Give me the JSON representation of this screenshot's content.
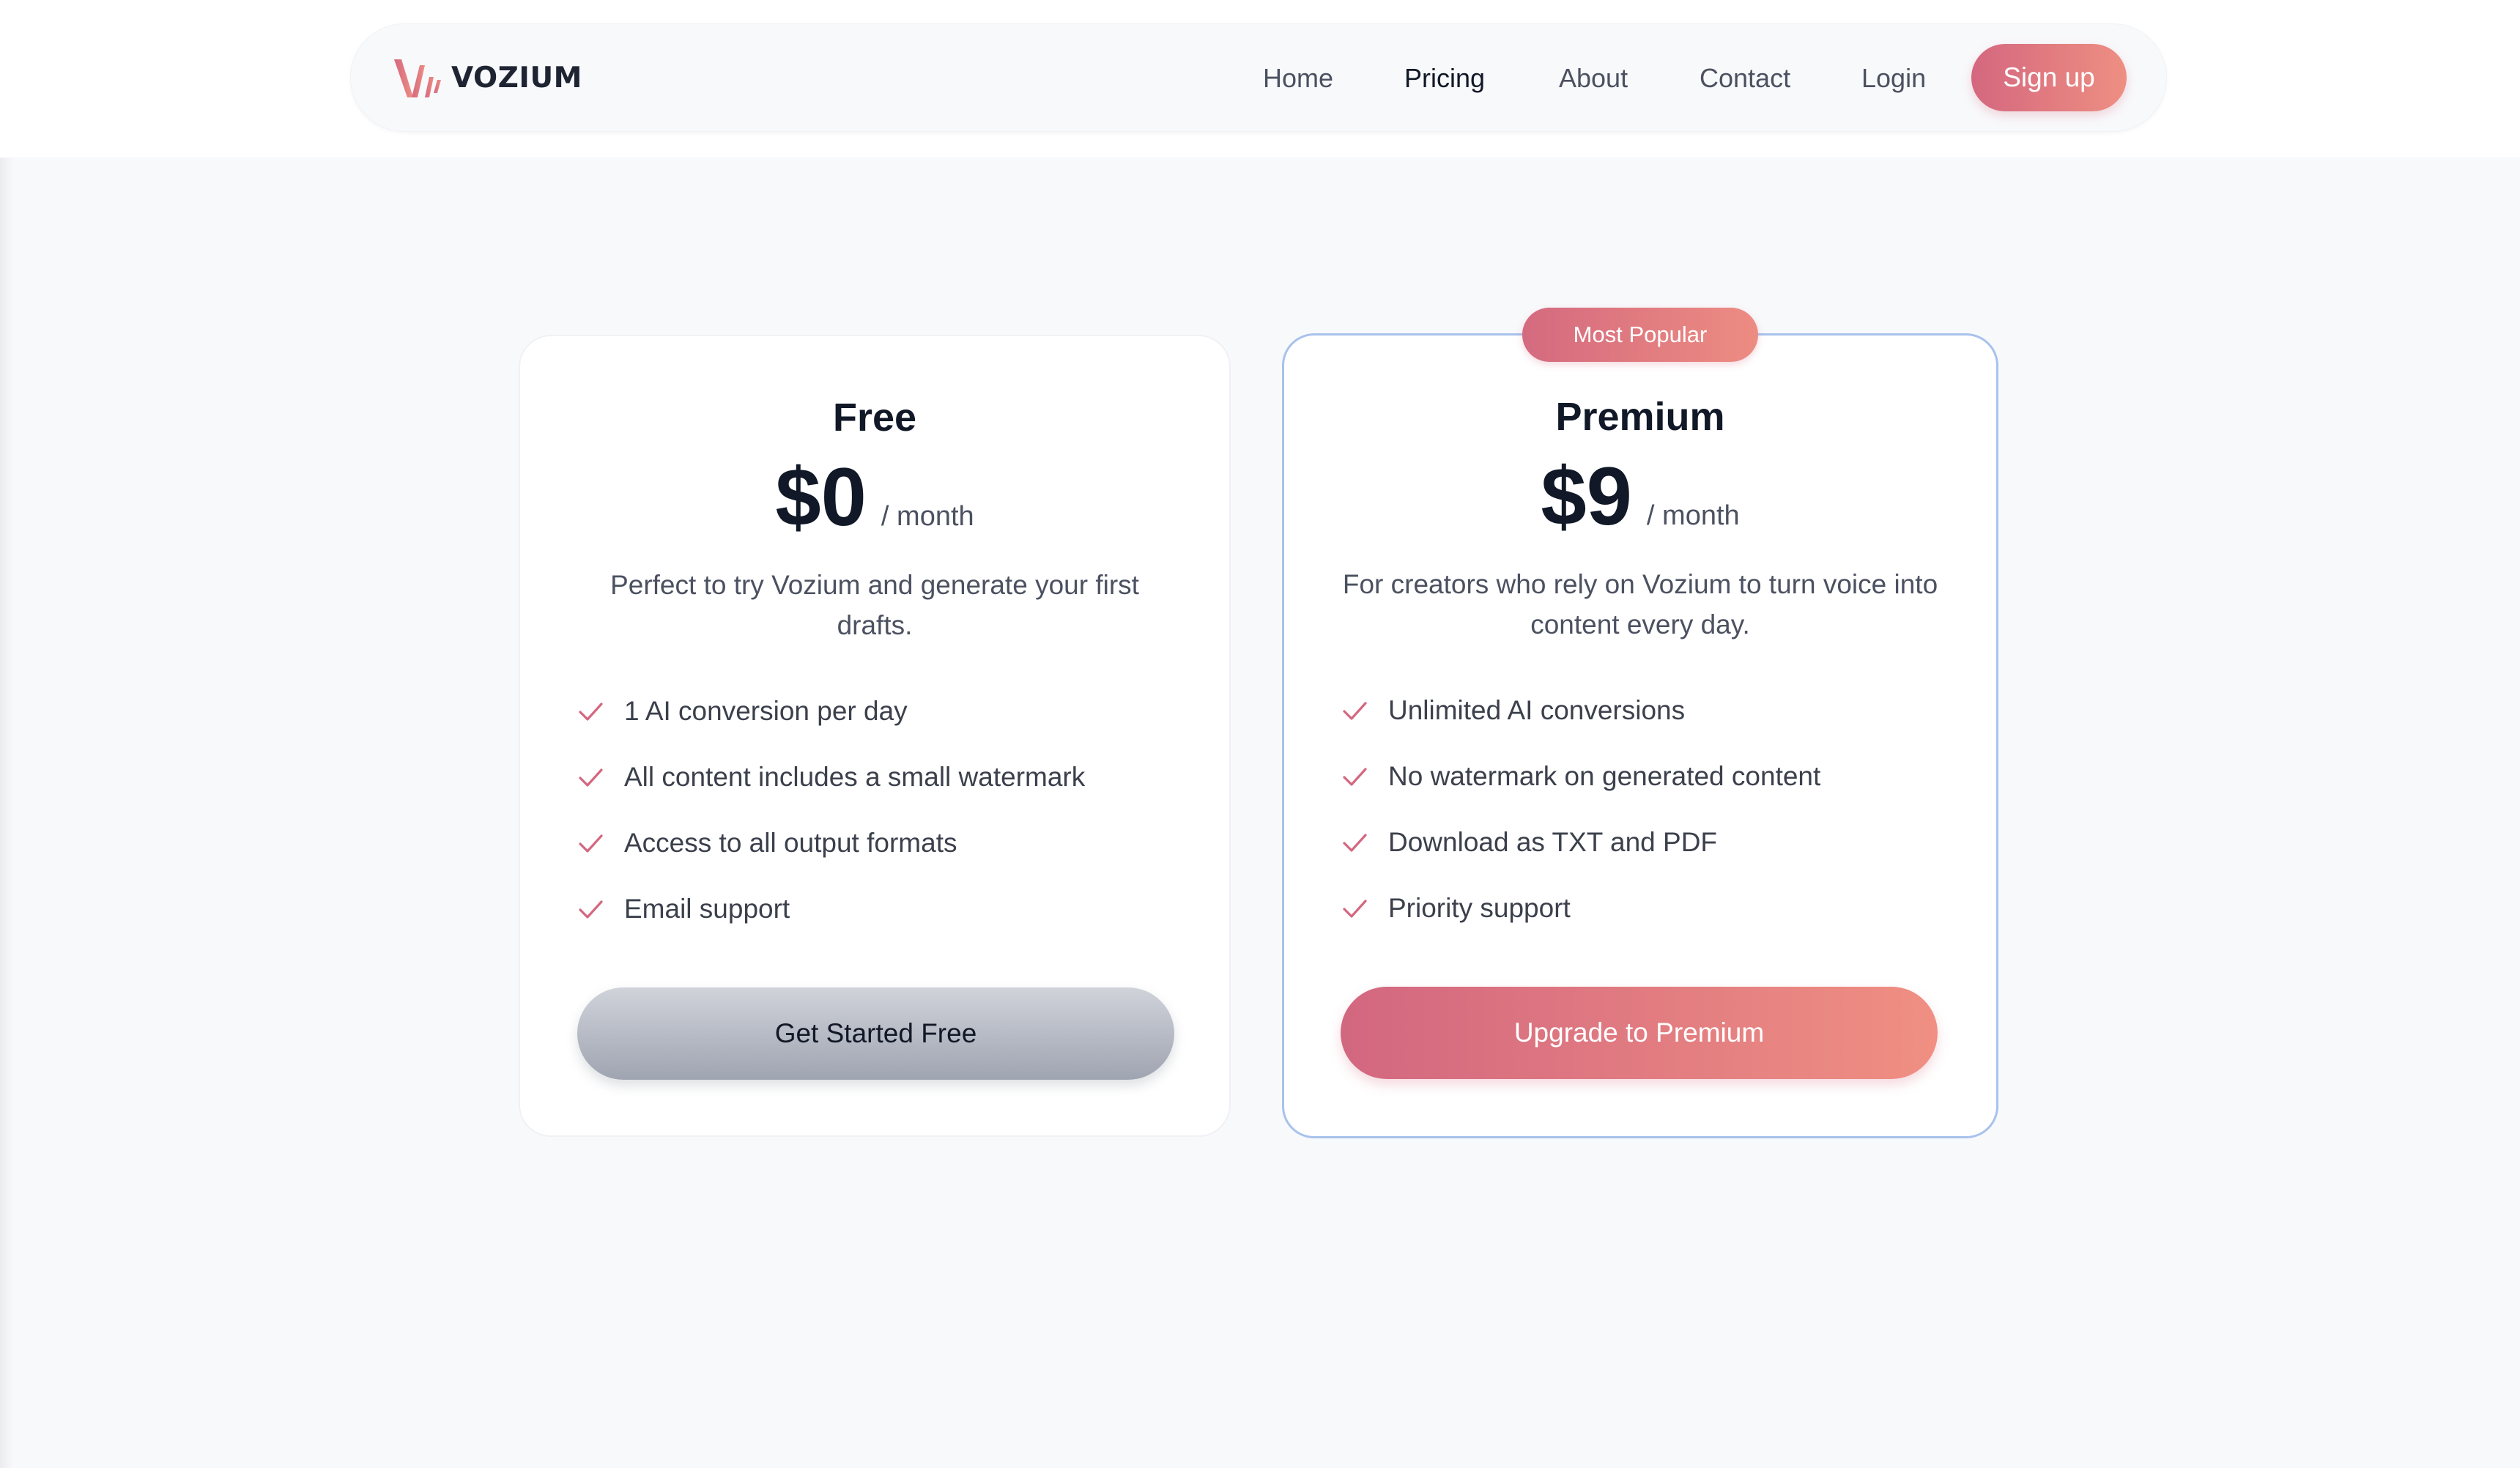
{
  "colors": {
    "accent_start": "#d4677f",
    "accent_end": "#ee8f82",
    "premium_border": "#a7c2ec",
    "page_background": "#f8f9fb"
  },
  "brand": {
    "logo_icon": "vozium-waveform-logo-icon",
    "name": "VOZIUM"
  },
  "nav": {
    "items": [
      {
        "label": "Home",
        "active": false
      },
      {
        "label": "Pricing",
        "active": true
      },
      {
        "label": "About",
        "active": false
      },
      {
        "label": "Contact",
        "active": false
      },
      {
        "label": "Login",
        "active": false
      }
    ],
    "signup_label": "Sign up"
  },
  "plans": [
    {
      "name": "Free",
      "price": "$0",
      "period": "/ month",
      "description": "Perfect to try Vozium and generate your first drafts.",
      "features": [
        "1 AI conversion per day",
        "All content includes a small watermark",
        "Access to all output formats",
        "Email support"
      ],
      "cta": "Get Started Free"
    },
    {
      "name": "Premium",
      "badge": "Most Popular",
      "price": "$9",
      "period": "/ month",
      "description": "For creators who rely on Vozium to turn voice into content every day.",
      "features": [
        "Unlimited AI conversions",
        "No watermark on generated content",
        "Download as TXT and PDF",
        "Priority support"
      ],
      "cta": "Upgrade to Premium"
    }
  ],
  "icons": {
    "feature_check": "check-icon"
  }
}
